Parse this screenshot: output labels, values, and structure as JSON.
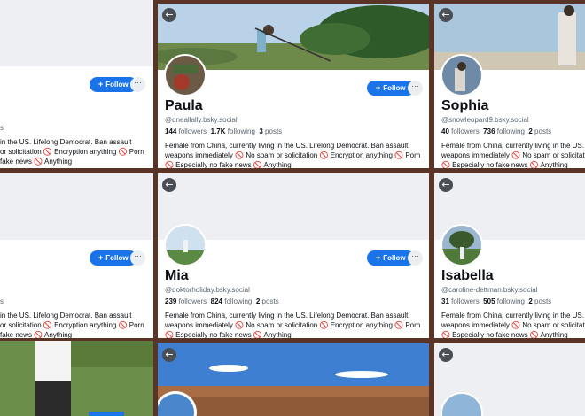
{
  "follow_label": "Follow",
  "more_label": "···",
  "back_glyph": "←",
  "no_glyph": "🚫",
  "bio_lines": [
    "Female from China, currently living in the US. Lifelong Democrat. Ban assault",
    "weapons immediately 🚫 No spam or solicitation 🚫 Encryption anything 🚫 Porn",
    "🚫 Especially no fake news 🚫 Anything"
  ],
  "profiles": [
    {
      "name": "",
      "handle": "",
      "followers": "",
      "following": "",
      "posts": "",
      "bio": [
        "in the US. Lifelong Democrat. Ban assault",
        "or solicitation 🚫 Encryption anything 🚫 Porn",
        "fake news 🚫 Anything"
      ],
      "stats_partial": "s"
    },
    {
      "name": "Paula",
      "handle": "@dneallally.bsky.social",
      "followers": "144",
      "following": "1.7K",
      "posts": "3",
      "followers_label": "followers",
      "following_label": "following",
      "posts_label": "posts"
    },
    {
      "name": "Sophia",
      "handle": "@snowleopard9.bsky.social",
      "followers": "40",
      "following": "736",
      "posts": "2",
      "followers_label": "followers",
      "following_label": "following",
      "posts_label": "posts",
      "bio": [
        "Female from China, currently living in the US.",
        "weapons immediately 🚫 No spam or solicitati",
        "🚫 Especially no fake news 🚫 Anything"
      ]
    },
    {
      "name": "",
      "handle": "",
      "followers": "",
      "following": "",
      "posts": "",
      "bio": [
        "in the US. Lifelong Democrat. Ban assault",
        "or solicitation 🚫 Encryption anything 🚫 Porn",
        "fake news 🚫 Anything"
      ],
      "stats_partial": "s"
    },
    {
      "name": "Mia",
      "handle": "@doktorholiday.bsky.social",
      "followers": "239",
      "following": "824",
      "posts": "2",
      "followers_label": "followers",
      "following_label": "following",
      "posts_label": "posts"
    },
    {
      "name": "Isabella",
      "handle": "@caroline-dettman.bsky.social",
      "followers": "31",
      "following": "505",
      "posts": "2",
      "followers_label": "followers",
      "following_label": "following",
      "posts_label": "posts",
      "bio": [
        "Female from China, currently living in the US.",
        "weapons immediately 🚫 No spam or solicitati",
        "🚫 Especially no fake news 🚫 Anything"
      ]
    }
  ]
}
